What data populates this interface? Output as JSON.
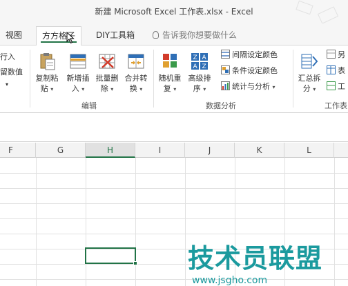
{
  "window": {
    "title": "新建 Microsoft Excel 工作表.xlsx - Excel"
  },
  "tabs": [
    {
      "label": "视图"
    },
    {
      "label": "方方格子"
    },
    {
      "label": "DIY工具箱"
    }
  ],
  "tellme": {
    "label": "告诉我你想要做什么"
  },
  "ribbon": {
    "left_partial": {
      "line1": "行入",
      "line2": "留数值"
    },
    "edit_group": {
      "label": "编辑",
      "buttons": [
        {
          "line1": "复制粘",
          "line2": "贴"
        },
        {
          "line1": "新增插",
          "line2": "入"
        },
        {
          "line1": "批量删",
          "line2": "除"
        },
        {
          "line1": "合并转",
          "line2": "换"
        }
      ]
    },
    "analysis_group": {
      "label": "数据分析",
      "buttons": [
        {
          "line1": "随机重",
          "line2": "复"
        },
        {
          "line1": "高级排",
          "line2": "序"
        }
      ],
      "small_buttons": [
        {
          "label": "间隔设定颜色"
        },
        {
          "label": "条件设定颜色"
        },
        {
          "label": "统计与分析"
        }
      ]
    },
    "sum_group": {
      "label": "工作表",
      "buttons": [
        {
          "line1": "汇总拆",
          "line2": "分"
        }
      ],
      "partial_items": [
        "另",
        "表",
        "工"
      ]
    }
  },
  "grid": {
    "columns": [
      "F",
      "G",
      "H",
      "I",
      "J",
      "K",
      "L"
    ],
    "selected_column": "H"
  },
  "watermark": {
    "title": "技术员联盟",
    "url": "www.jsgho.com"
  },
  "colors": {
    "accent": "#217346",
    "watermark": "#1b9a9e"
  }
}
